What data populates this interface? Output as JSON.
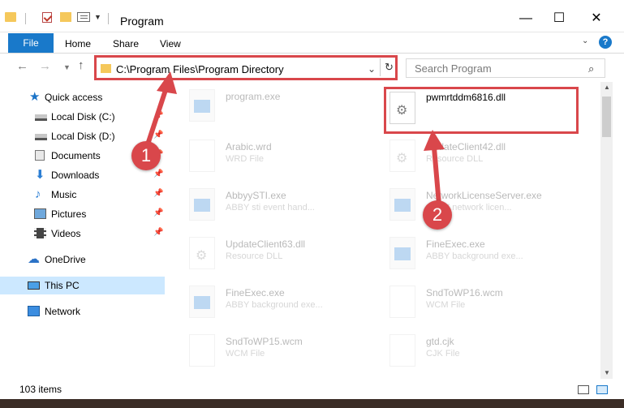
{
  "window": {
    "title": "Program",
    "minimize": "—",
    "maximize": "☐",
    "close": "✕"
  },
  "ribbon": {
    "tabs": [
      "File",
      "Home",
      "Share",
      "View"
    ],
    "help": "?"
  },
  "address": {
    "path": "C:\\Program Files\\Program Directory"
  },
  "search": {
    "placeholder": "Search Program"
  },
  "sidebar": {
    "items": [
      {
        "label": "Quick access"
      },
      {
        "label": "Local Disk (C:)"
      },
      {
        "label": "Local Disk (D:)"
      },
      {
        "label": "Documents"
      },
      {
        "label": "Downloads"
      },
      {
        "label": "Music"
      },
      {
        "label": "Pictures"
      },
      {
        "label": "Videos"
      },
      {
        "label": "OneDrive"
      },
      {
        "label": "This PC"
      },
      {
        "label": "Network"
      }
    ]
  },
  "files": [
    {
      "name": "program.exe",
      "type": ""
    },
    {
      "name": "pwmrtddm6816.dll",
      "type": ""
    },
    {
      "name": "Arabic.wrd",
      "type": "WRD File"
    },
    {
      "name": "UpdateClient42.dll",
      "type": "Resource DLL"
    },
    {
      "name": "AbbyySTI.exe",
      "type": "ABBY sti event hand..."
    },
    {
      "name": "NetworkLicenseServer.exe",
      "type": "ABBY network licen..."
    },
    {
      "name": "UpdateClient63.dll",
      "type": "Resource DLL"
    },
    {
      "name": "FineExec.exe",
      "type": "ABBY background exe..."
    },
    {
      "name": "FineExec.exe",
      "type": "ABBY background exe..."
    },
    {
      "name": "SndToWP16.wcm",
      "type": "WCM File"
    },
    {
      "name": "SndToWP15.wcm",
      "type": "WCM File"
    },
    {
      "name": "gtd.cjk",
      "type": "CJK File"
    }
  ],
  "status": {
    "count": "103 items"
  },
  "annotations": {
    "step1": "1",
    "step2": "2",
    "color": "#d9474b"
  }
}
